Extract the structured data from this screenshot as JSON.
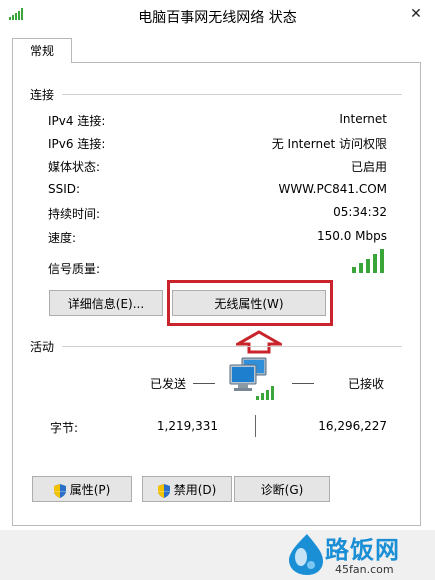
{
  "window": {
    "title": "电脑百事网无线网络 状态",
    "close_glyph": "✕"
  },
  "tabs": [
    {
      "label": "常规"
    }
  ],
  "connection": {
    "title": "连接",
    "rows": [
      {
        "label": "IPv4 连接:",
        "value": "Internet"
      },
      {
        "label": "IPv6 连接:",
        "value": "无 Internet 访问权限"
      },
      {
        "label": "媒体状态:",
        "value": "已启用"
      },
      {
        "label": "SSID:",
        "value": "WWW.PC841.COM"
      },
      {
        "label": "持续时间:",
        "value": "05:34:32"
      },
      {
        "label": "速度:",
        "value": "150.0 Mbps"
      }
    ],
    "signal_label": "信号质量:",
    "signal_bars": 5,
    "details_button": "详细信息(E)...",
    "wireless_properties_button": "无线属性(W)"
  },
  "activity": {
    "title": "活动",
    "sent_label": "已发送",
    "received_label": "已接收",
    "bytes_label": "字节:",
    "bytes_sent": "1,219,331",
    "bytes_received": "16,296,227"
  },
  "buttons": {
    "properties": "属性(P)",
    "disable": "禁用(D)",
    "diagnose": "诊断(G)"
  },
  "watermark": {
    "brand": "路饭网",
    "domain": "45fan.com"
  },
  "colors": {
    "highlight": "#c9242b",
    "signal": "#3aa63a",
    "watermark_blue": "#1a8fd6"
  },
  "icons": {
    "title": "signal-bars-icon",
    "network": "network-computers-icon",
    "shield": "uac-shield-icon",
    "arrow": "up-arrow-icon"
  }
}
